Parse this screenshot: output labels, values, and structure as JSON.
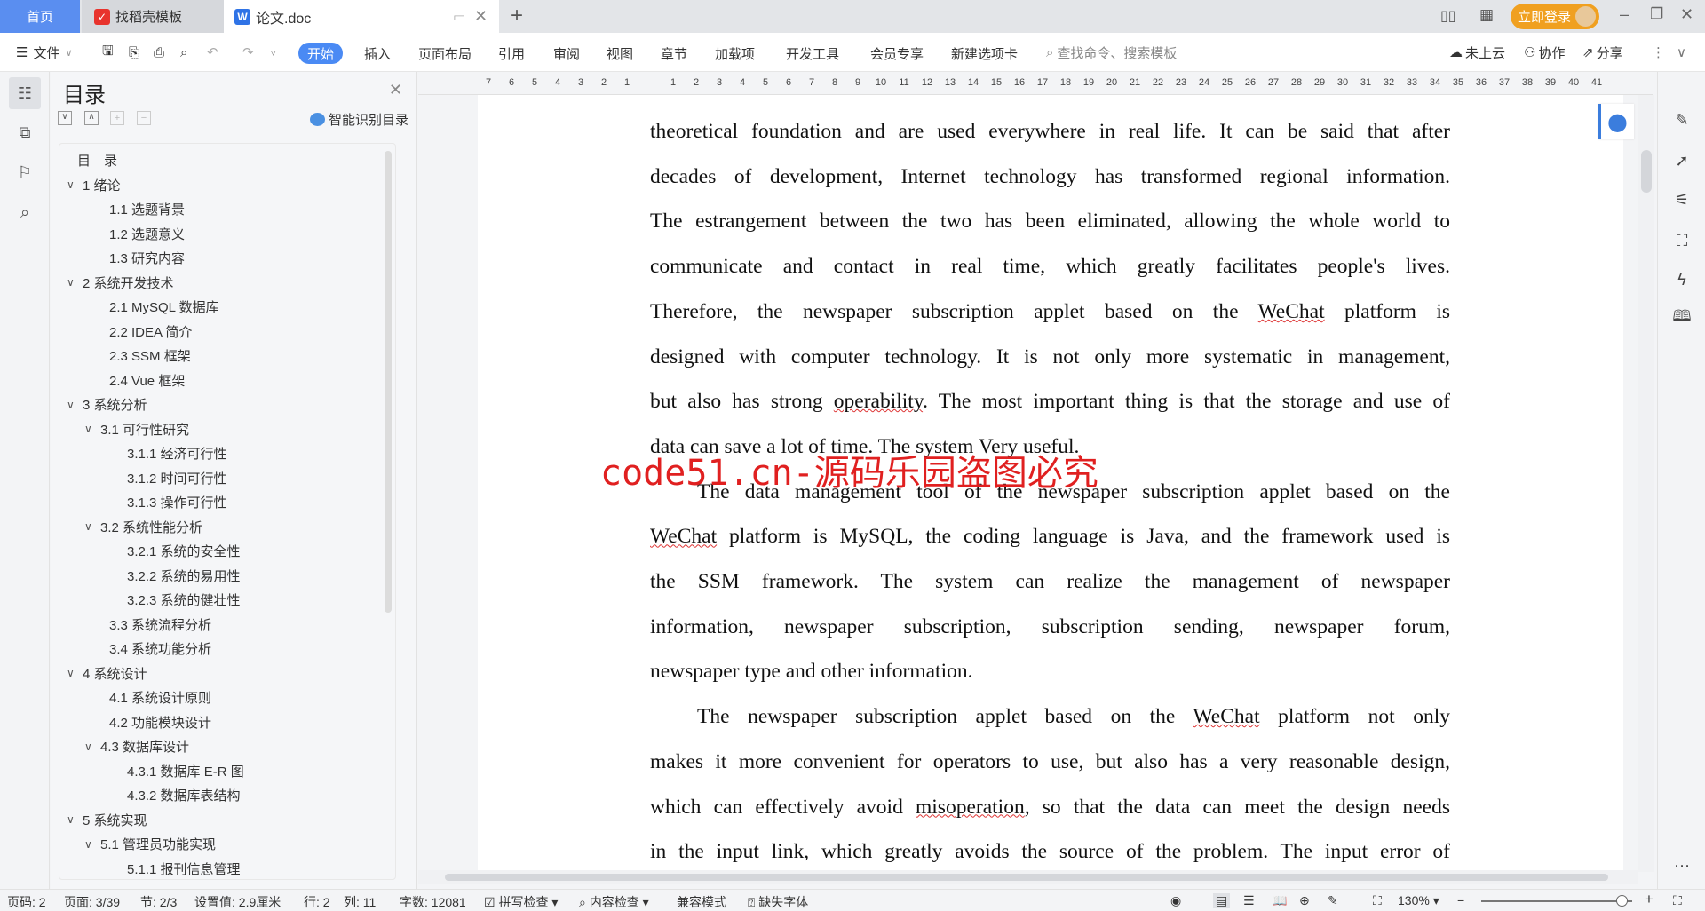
{
  "tabs": {
    "home": "首页",
    "template": "找稻壳模板",
    "document": "论文.doc",
    "new_tab_icon": "plus-icon"
  },
  "window": {
    "login": "立即登录",
    "accent": "#f0a020",
    "tab_active": "#5a8ef0"
  },
  "toolbar": {
    "file": "文件",
    "ribbon": [
      "开始",
      "插入",
      "页面布局",
      "引用",
      "审阅",
      "视图",
      "章节",
      "加载项",
      "开发工具",
      "会员专享",
      "新建选项卡"
    ],
    "search_placeholder": "查找命令、搜索模板",
    "cloud": "未上云",
    "collab": "协作",
    "share": "分享"
  },
  "toc": {
    "title": "目录",
    "smart": "智能识别目录",
    "items": [
      {
        "label": "目　录",
        "level": 0,
        "chevron": false
      },
      {
        "label": "1  绪论",
        "level": 0,
        "chevron": true
      },
      {
        "label": "1.1  选题背景",
        "level": 1,
        "chevron": false
      },
      {
        "label": "1.2  选题意义",
        "level": 1,
        "chevron": false
      },
      {
        "label": "1.3  研究内容",
        "level": 1,
        "chevron": false
      },
      {
        "label": "2  系统开发技术",
        "level": 0,
        "chevron": true
      },
      {
        "label": "2.1  MySQL 数据库",
        "level": 1,
        "chevron": false
      },
      {
        "label": "2.2  IDEA 简介",
        "level": 1,
        "chevron": false
      },
      {
        "label": "2.3  SSM 框架",
        "level": 1,
        "chevron": false
      },
      {
        "label": "2.4  Vue 框架",
        "level": 1,
        "chevron": false
      },
      {
        "label": "3  系统分析",
        "level": 0,
        "chevron": true
      },
      {
        "label": "3.1  可行性研究",
        "level": 1,
        "chevron": true
      },
      {
        "label": "3.1.1  经济可行性",
        "level": 2,
        "chevron": false
      },
      {
        "label": "3.1.2  时间可行性",
        "level": 2,
        "chevron": false
      },
      {
        "label": "3.1.3  操作可行性",
        "level": 2,
        "chevron": false
      },
      {
        "label": "3.2  系统性能分析",
        "level": 1,
        "chevron": true
      },
      {
        "label": "3.2.1  系统的安全性",
        "level": 2,
        "chevron": false
      },
      {
        "label": "3.2.2  系统的易用性",
        "level": 2,
        "chevron": false
      },
      {
        "label": "3.2.3  系统的健壮性",
        "level": 2,
        "chevron": false
      },
      {
        "label": "3.3  系统流程分析",
        "level": 1,
        "chevron": false
      },
      {
        "label": "3.4  系统功能分析",
        "level": 1,
        "chevron": false
      },
      {
        "label": "4  系统设计",
        "level": 0,
        "chevron": true
      },
      {
        "label": "4.1  系统设计原则",
        "level": 1,
        "chevron": false
      },
      {
        "label": "4.2  功能模块设计",
        "level": 1,
        "chevron": false
      },
      {
        "label": "4.3  数据库设计",
        "level": 1,
        "chevron": true
      },
      {
        "label": "4.3.1  数据库 E-R 图",
        "level": 2,
        "chevron": false
      },
      {
        "label": "4.3.2  数据库表结构",
        "level": 2,
        "chevron": false
      },
      {
        "label": "5  系统实现",
        "level": 0,
        "chevron": true
      },
      {
        "label": "5.1  管理员功能实现",
        "level": 1,
        "chevron": true
      },
      {
        "label": "5.1.1  报刊信息管理",
        "level": 2,
        "chevron": false
      }
    ]
  },
  "ruler": [
    "7",
    "6",
    "5",
    "4",
    "3",
    "2",
    "1",
    "",
    "1",
    "2",
    "3",
    "4",
    "5",
    "6",
    "7",
    "8",
    "9",
    "10",
    "11",
    "12",
    "13",
    "14",
    "15",
    "16",
    "17",
    "18",
    "19",
    "20",
    "21",
    "22",
    "23",
    "24",
    "25",
    "26",
    "27",
    "28",
    "29",
    "30",
    "31",
    "32",
    "33",
    "34",
    "35",
    "36",
    "37",
    "38",
    "39",
    "40",
    "41"
  ],
  "document": {
    "lines": [
      {
        "t": "theoretical foundation and are used everywhere in real life. It can be said that after"
      },
      {
        "t": "decades of development, Internet technology has transformed regional information."
      },
      {
        "t": "The estrangement between the two has been eliminated, allowing the whole world to"
      },
      {
        "t": "communicate and contact in real time, which greatly facilitates people's lives."
      },
      {
        "t": "Therefore, the newspaper subscription applet based on the WeChat platform is"
      },
      {
        "t": "designed with computer technology. It is not only more systematic in management,"
      },
      {
        "t": "but also has strong operability. The most important thing is that the storage and use of"
      },
      {
        "t": "data can save a lot of time. The system Very useful.",
        "last": true
      },
      {
        "t": "The data management tool of the newspaper subscription applet based on the",
        "indent": true
      },
      {
        "t": "WeChat platform is MySQL, the coding language is Java, and the framework used is"
      },
      {
        "t": "the SSM framework. The system can realize the management of newspaper"
      },
      {
        "t": "information, newspaper subscription, subscription sending, newspaper forum,"
      },
      {
        "t": "newspaper type and other information.",
        "last": true
      },
      {
        "t": "The newspaper subscription applet based on the WeChat platform not only",
        "indent": true
      },
      {
        "t": "makes it more convenient for operators to use, but also has a very reasonable design,"
      },
      {
        "t": "which can effectively avoid misoperation, so that the data can meet the design needs"
      },
      {
        "t": "in the input link, which greatly avoids the source of the problem. The input error of"
      }
    ],
    "watermark": "code51.cn-源码乐园盗图必究"
  },
  "status": {
    "page_no": "页码: 2",
    "pages": "页面: 3/39",
    "section": "节: 2/3",
    "setting": "设置值: 2.9厘米",
    "row": "行: 2",
    "col": "列: 11",
    "words": "字数: 12081",
    "spell": "拼写检查",
    "content": "内容检查",
    "compat": "兼容模式",
    "font_missing": "缺失字体",
    "zoom": "130%",
    "zoom_level": 130
  }
}
